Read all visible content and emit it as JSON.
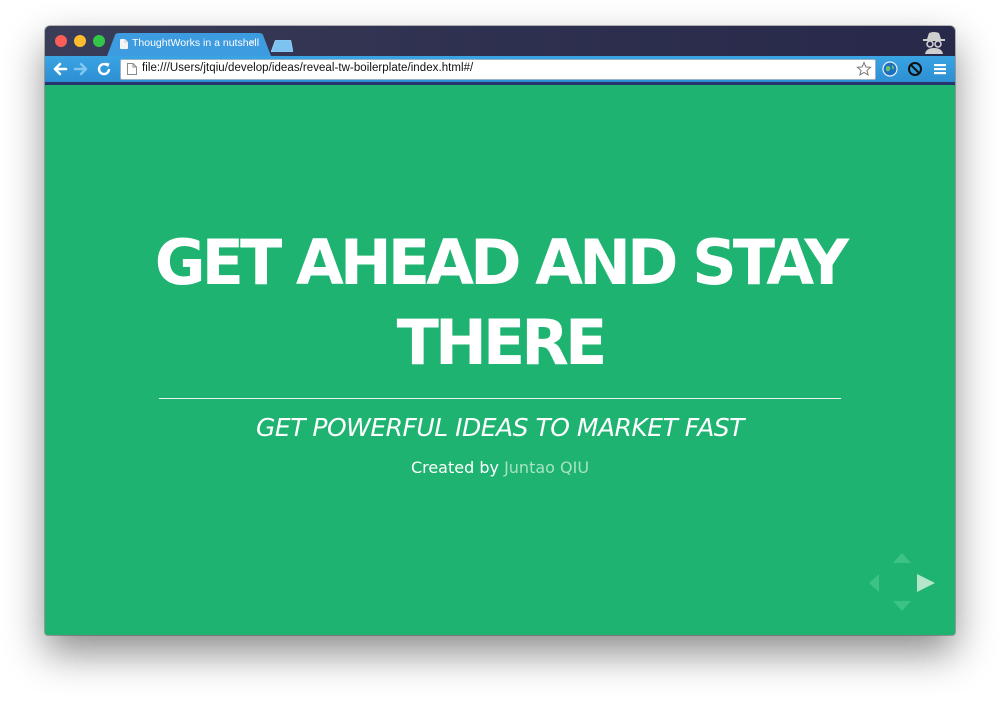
{
  "browser": {
    "tab": {
      "title": "ThoughtWorks in a nutshell",
      "close": "×"
    },
    "address_bar": {
      "url": "file:///Users/jtqiu/develop/ideas/reveal-tw-boilerplate/index.html#/"
    }
  },
  "slide": {
    "title_line1": "GET AHEAD AND STAY",
    "title_line2": "THERE",
    "subtitle": "GET POWERFUL IDEAS TO MARKET FAST",
    "credit_prefix": "Created by ",
    "credit_author": "Juntao QIU"
  },
  "colors": {
    "slide_background": "#1eb370",
    "toolbar": "#2c8fd3",
    "titlebar": "#2f3150",
    "link": "#a7e3c3"
  },
  "icons": [
    "back-arrow-icon",
    "forward-arrow-icon",
    "reload-icon",
    "page-icon",
    "star-icon",
    "globe-icon",
    "blocked-icon",
    "menu-icon",
    "incognito-icon",
    "nav-arrows-icon"
  ]
}
